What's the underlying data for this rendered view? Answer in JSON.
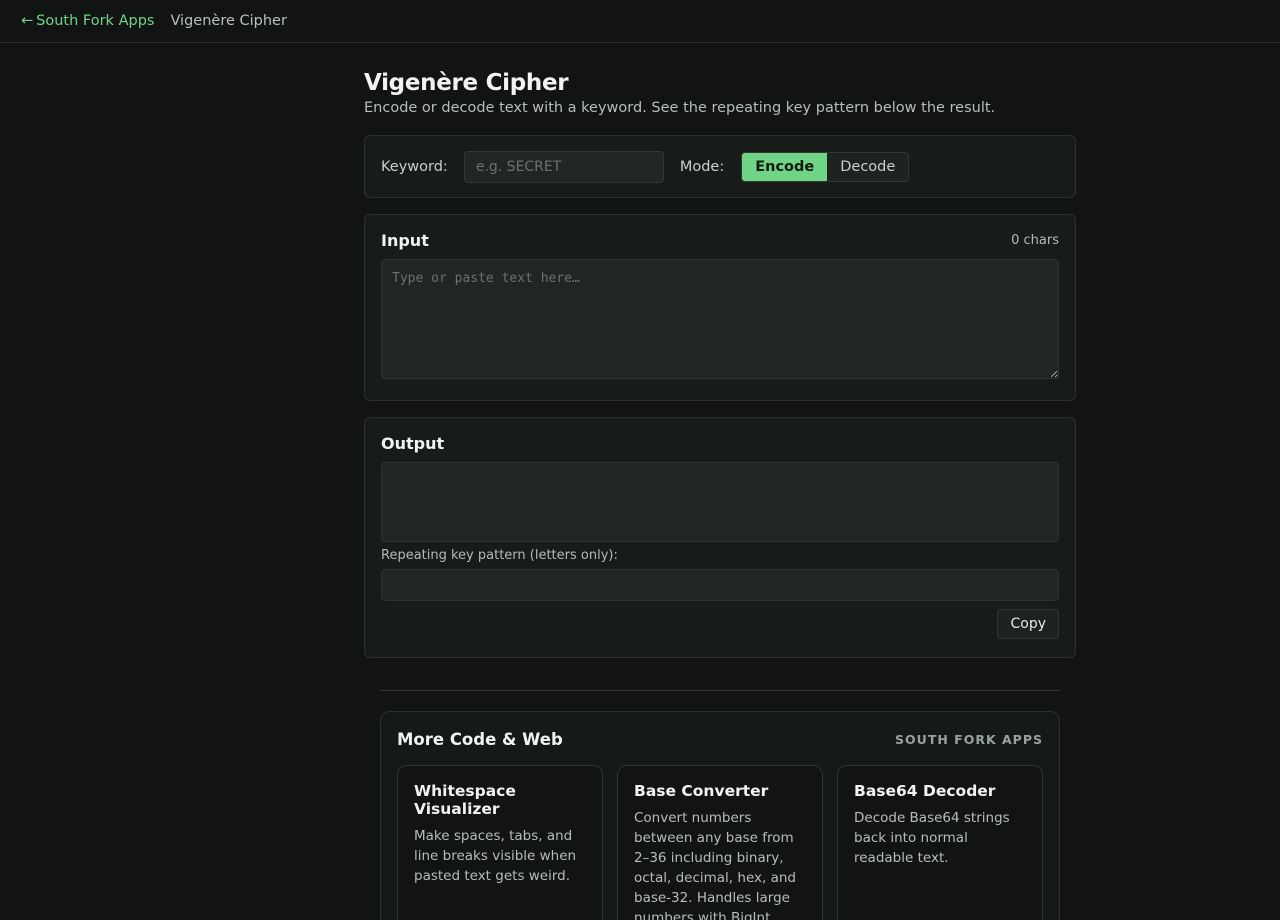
{
  "nav": {
    "back_arrow": "←",
    "back_label": "South Fork Apps",
    "current": "Vigenère Cipher"
  },
  "page": {
    "title": "Vigenère Cipher",
    "subtitle": "Encode or decode text with a keyword. See the repeating key pattern below the result."
  },
  "controls": {
    "keyword_label": "Keyword:",
    "keyword_value": "",
    "keyword_placeholder": "e.g. SECRET",
    "mode_label": "Mode:",
    "mode_options": [
      "Encode",
      "Decode"
    ],
    "mode_selected": "Encode"
  },
  "input": {
    "title": "Input",
    "char_count": "0 chars",
    "value": "",
    "placeholder": "Type or paste text here…"
  },
  "output": {
    "title": "Output",
    "value": "",
    "pattern_label": "Repeating key pattern (letters only):",
    "pattern_value": "",
    "copy_label": "Copy"
  },
  "more": {
    "title": "More Code & Web",
    "brand": "SOUTH FORK APPS",
    "cards": [
      {
        "title": "Whitespace Visualizer",
        "desc": "Make spaces, tabs, and line breaks visible when pasted text gets weird."
      },
      {
        "title": "Base Converter",
        "desc": "Convert numbers between any base from 2–36 including binary, octal, decimal, hex, and base-32. Handles large numbers with BigInt."
      },
      {
        "title": "Base64 Decoder",
        "desc": "Decode Base64 strings back into normal readable text."
      }
    ]
  },
  "colors": {
    "accent": "#6fd486",
    "background": "#111412",
    "panel": "#181c19"
  }
}
